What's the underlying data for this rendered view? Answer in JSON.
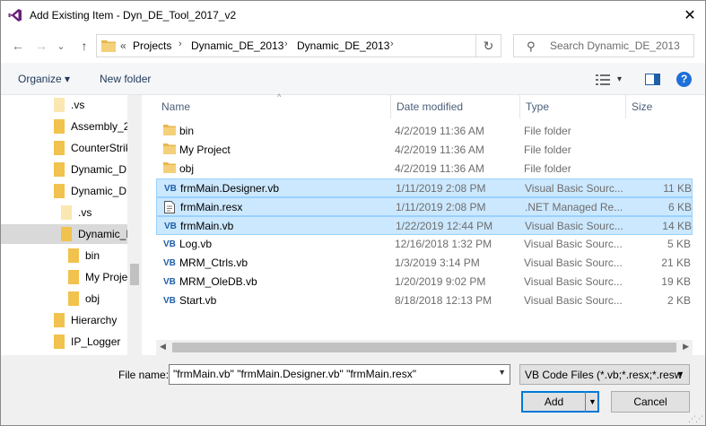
{
  "window": {
    "title": "Add Existing Item - Dyn_DE_Tool_2017_v2",
    "close_glyph": "✕"
  },
  "nav": {
    "back_glyph": "←",
    "forward_glyph": "→",
    "recent_glyph": "⌄",
    "up_glyph": "↑",
    "breadcrumb_lead": "«",
    "breadcrumbs": [
      "Projects",
      "Dynamic_DE_2013",
      "Dynamic_DE_2013"
    ],
    "breadcrumb_sep": "›",
    "refresh_glyph": "↻",
    "search_placeholder": "Search Dynamic_DE_2013",
    "search_glyph": "⚲"
  },
  "toolbar": {
    "organize_label": "Organize ▾",
    "new_folder_label": "New folder",
    "view_glyph": "▾",
    "help_glyph": "?"
  },
  "tree": {
    "items": [
      {
        "label": ".vs",
        "type": "folder-light"
      },
      {
        "label": "Assembly_2",
        "type": "folder"
      },
      {
        "label": "CounterStrik",
        "type": "folder"
      },
      {
        "label": "Dynamic_DE",
        "type": "folder"
      },
      {
        "label": "Dynamic_DE",
        "type": "folder"
      },
      {
        "label": ".vs",
        "type": "folder-light"
      },
      {
        "label": "Dynamic_I",
        "type": "folder"
      },
      {
        "label": "bin",
        "type": "folder"
      },
      {
        "label": "My Proje",
        "type": "folder"
      },
      {
        "label": "obj",
        "type": "folder"
      },
      {
        "label": "Hierarchy",
        "type": "folder"
      },
      {
        "label": "IP_Logger",
        "type": "folder"
      }
    ]
  },
  "columns": {
    "name": "Name",
    "date": "Date modified",
    "type": "Type",
    "size": "Size",
    "sort_glyph": "^"
  },
  "files": [
    {
      "icon": "folder",
      "name": "bin",
      "date": "4/2/2019 11:36 AM",
      "type": "File folder",
      "size": "",
      "selected": false
    },
    {
      "icon": "folder",
      "name": "My Project",
      "date": "4/2/2019 11:36 AM",
      "type": "File folder",
      "size": "",
      "selected": false
    },
    {
      "icon": "folder",
      "name": "obj",
      "date": "4/2/2019 11:36 AM",
      "type": "File folder",
      "size": "",
      "selected": false
    },
    {
      "icon": "vb",
      "name": "frmMain.Designer.vb",
      "date": "1/11/2019 2:08 PM",
      "type": "Visual Basic Sourc...",
      "size": "11 KB",
      "selected": true
    },
    {
      "icon": "resx",
      "name": "frmMain.resx",
      "date": "1/11/2019 2:08 PM",
      "type": ".NET Managed Re...",
      "size": "6 KB",
      "selected": true
    },
    {
      "icon": "vb",
      "name": "frmMain.vb",
      "date": "1/22/2019 12:44 PM",
      "type": "Visual Basic Sourc...",
      "size": "14 KB",
      "selected": true
    },
    {
      "icon": "vb",
      "name": "Log.vb",
      "date": "12/16/2018 1:32 PM",
      "type": "Visual Basic Sourc...",
      "size": "5 KB",
      "selected": false
    },
    {
      "icon": "vb",
      "name": "MRM_Ctrls.vb",
      "date": "1/3/2019 3:14 PM",
      "type": "Visual Basic Sourc...",
      "size": "21 KB",
      "selected": false
    },
    {
      "icon": "vb",
      "name": "MRM_OleDB.vb",
      "date": "1/20/2019 9:02 PM",
      "type": "Visual Basic Sourc...",
      "size": "19 KB",
      "selected": false
    },
    {
      "icon": "vb",
      "name": "Start.vb",
      "date": "8/18/2018 12:13 PM",
      "type": "Visual Basic Sourc...",
      "size": "2 KB",
      "selected": false
    }
  ],
  "bottom": {
    "file_name_label": "File name:",
    "file_name_value": "\"frmMain.vb\" \"frmMain.Designer.vb\" \"frmMain.resx\"",
    "file_type_value": "VB Code Files (*.vb;*.resx;*.resw",
    "add_label": "Add",
    "cancel_label": "Cancel"
  },
  "colors": {
    "selection_bg": "#cce8ff",
    "selection_border": "#99d1ff",
    "accent": "#0078d7",
    "folder": "#e8b84b",
    "vs_purple": "#68217a"
  }
}
